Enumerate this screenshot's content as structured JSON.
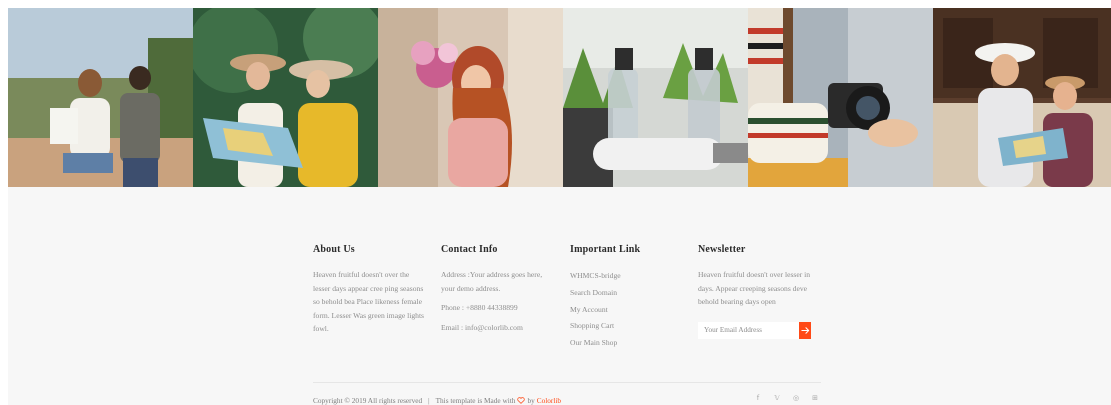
{
  "gallery": {
    "tiles": [
      {
        "subject": "travel-couple-photo"
      },
      {
        "subject": "women-with-map-photo"
      },
      {
        "subject": "woman-with-flowers-photo"
      },
      {
        "subject": "spray-bottles-photo"
      },
      {
        "subject": "camera-photo"
      },
      {
        "subject": "tourists-with-map-photo"
      }
    ]
  },
  "footer": {
    "about": {
      "title": "About Us",
      "text": "Heaven fruitful doesn't over the lesser days appear cree ping seasons so behold bea Place likeness female form. Lesser Was green image lights fowl."
    },
    "contact": {
      "title": "Contact Info",
      "address": "Address :Your address goes here, your demo address.",
      "phone": "Phone : +8880 44338899",
      "email": "Email : info@colorlib.com"
    },
    "links": {
      "title": "Important Link",
      "items": [
        "WHMCS-bridge",
        "Search Domain",
        "My Account",
        "Shopping Cart",
        "Our Main Shop"
      ]
    },
    "newsletter": {
      "title": "Newsletter",
      "text": "Heaven fruitful doesn't over lesser in days. Appear creeping seasons deve behold bearing days open",
      "placeholder": "Your Email Address",
      "button_icon": "arrow-right-icon"
    },
    "copyright": {
      "text": "Copyright © 2019 All rights reserved",
      "separator": "|",
      "made_with": "This template is Made with",
      "by": "by",
      "brand": "Colorlib"
    },
    "social": [
      {
        "icon": "facebook-icon",
        "glyph": "f"
      },
      {
        "icon": "twitter-icon",
        "glyph": "𝕍"
      },
      {
        "icon": "dribbble-icon",
        "glyph": "◎"
      },
      {
        "icon": "behance-icon",
        "glyph": "⊞"
      }
    ],
    "colors": {
      "accent": "#ff4a17",
      "background": "#f7f7f7"
    }
  }
}
